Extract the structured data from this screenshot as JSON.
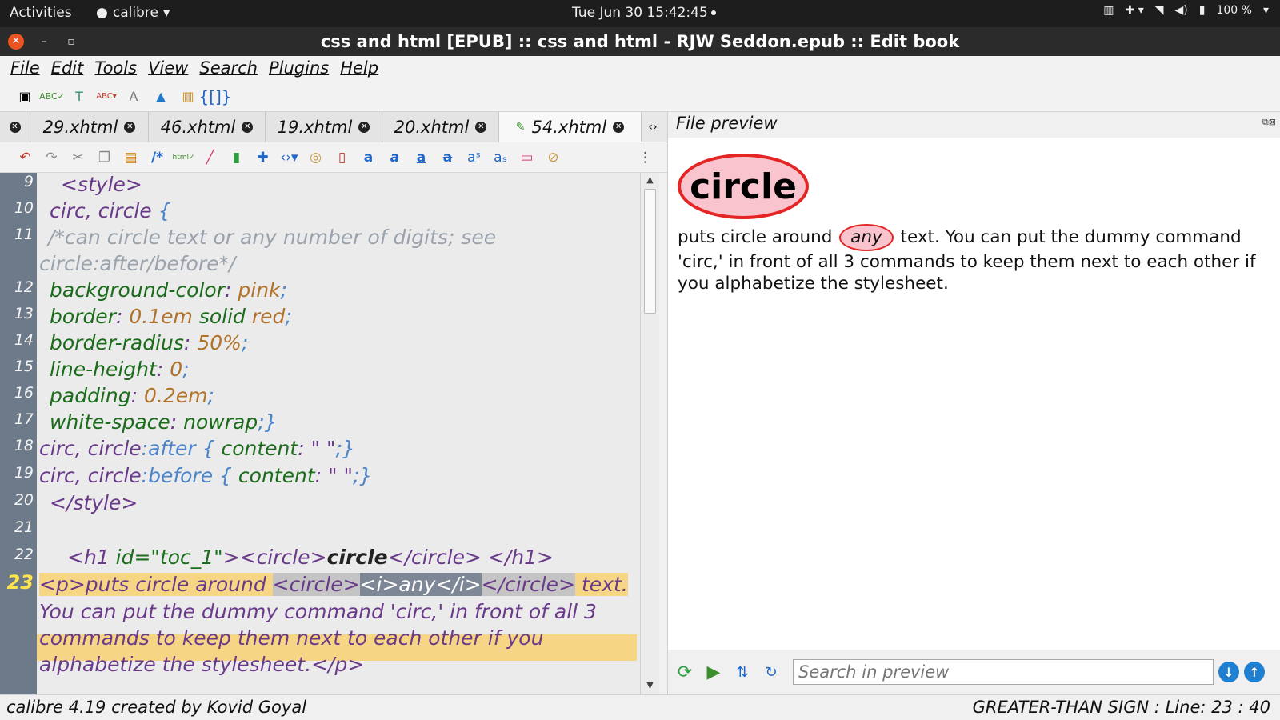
{
  "topbar": {
    "activities": "Activities",
    "app_name": "calibre",
    "clock": "Tue Jun 30  15:42:45",
    "battery": "100 %"
  },
  "window": {
    "title": "css and html [EPUB] :: css and html - RJW Seddon.epub :: Edit book"
  },
  "menu": [
    "File",
    "Edit",
    "Tools",
    "View",
    "Search",
    "Plugins",
    "Help"
  ],
  "tabs": [
    {
      "label": "29.xhtml",
      "active": false
    },
    {
      "label": "46.xhtml",
      "active": false
    },
    {
      "label": "19.xhtml",
      "active": false
    },
    {
      "label": "20.xhtml",
      "active": false
    },
    {
      "label": "54.xhtml",
      "active": true
    }
  ],
  "editor": {
    "current_line": 23,
    "line_numbers": [
      "9",
      "10",
      "11",
      "12",
      "13",
      "14",
      "15",
      "16",
      "17",
      "18",
      "19",
      "20",
      "21",
      "22",
      "23"
    ],
    "lines": {
      "l9": "<style>",
      "l10_sel": "circ, circle",
      "l10_brace": "{",
      "l11a": "/*can circle text or any number of digits; see",
      "l11b": "circle:after/before*/",
      "l12_prop": "background-color",
      "l12_val": "pink",
      "l13_prop": "border",
      "l13_val1": "0.1em",
      "l13_val2": "solid",
      "l13_val3": "red",
      "l14_prop": "border-radius",
      "l14_val": "50%",
      "l15_prop": "line-height",
      "l15_val": "0",
      "l16_prop": "padding",
      "l16_val": "0.2em",
      "l17_prop": "white-space",
      "l17_val": "nowrap",
      "l18_sel": "circ, circle",
      "l18_pseudo": ":after",
      "l18_prop": "content",
      "l18_val": "\" \"",
      "l19_sel": "circ, circle",
      "l19_pseudo": ":before",
      "l19_prop": "content",
      "l19_val": "\" \"",
      "l20": "</style>",
      "l22_tag_open": "<h1 ",
      "l22_attr": "id=",
      "l22_str": "\"toc_1\"",
      "l22_rest1": "><circle>",
      "l22_text": "circle",
      "l22_rest2": "</circle> </h1>",
      "l23_p": "<p>",
      "l23_text": "puts circle around ",
      "l23_circ_open": "<circle>",
      "l23_i": "<i>any</i>",
      "l23_circ_close": "</circle>",
      "l23_tail": " text.",
      "l24": "You can put the dummy command 'circ,' in front of all 3",
      "l25": "commands to keep them next to each other if you",
      "l26_text": "alphabetize the stylesheet.",
      "l26_close": "</p>"
    }
  },
  "preview": {
    "title": "File preview",
    "heading": "circle",
    "para_before": "puts circle around ",
    "para_circled": "any",
    "para_after": " text. You can put the dummy command 'circ,' in front of all 3 commands to keep them next to each other if you alphabetize the stylesheet.",
    "search_placeholder": "Search in preview"
  },
  "status": {
    "left": "calibre 4.19 created by Kovid Goyal",
    "right": "GREATER-THAN SIGN : Line: 23 : 40"
  },
  "colors": {
    "highlight": "#f6d684",
    "gutter": "#6c7a89",
    "circle_fill": "#f9c4cd",
    "circle_border": "#e52424"
  }
}
